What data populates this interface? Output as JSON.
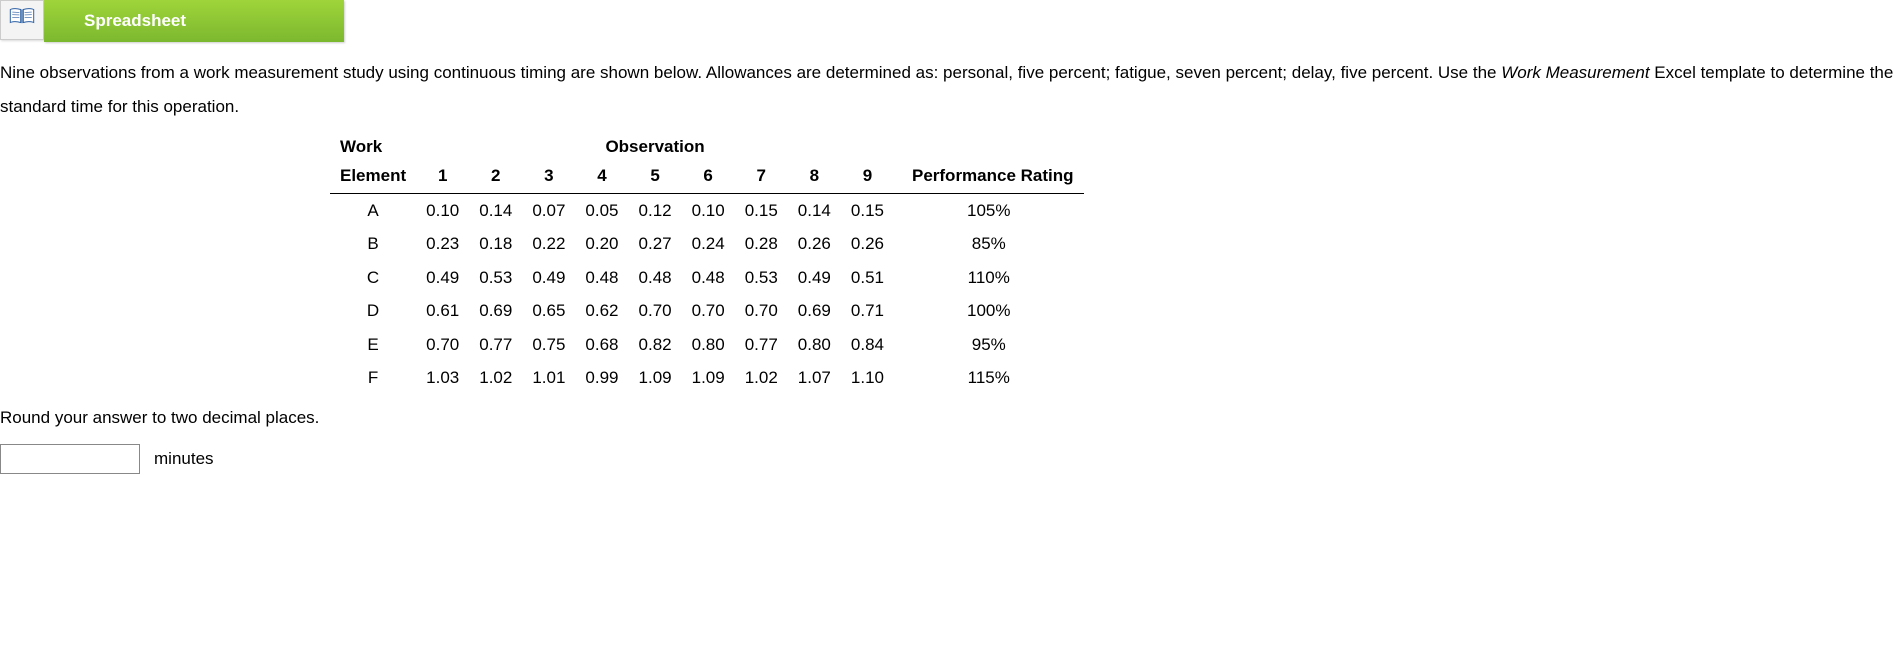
{
  "header": {
    "tab_label": "Spreadsheet"
  },
  "problem": {
    "text_part1": "Nine observations from a work measurement study using continuous timing are shown below. Allowances are determined as: personal, five percent; fatigue, seven percent; delay, five percent. Use the ",
    "text_emph": "Work Measurement",
    "text_part2": " Excel template to determine the standard time for this operation."
  },
  "table": {
    "header_group1": {
      "col1": "Work",
      "col_obs": "Observation"
    },
    "header_row": {
      "element": "Element",
      "obs": [
        "1",
        "2",
        "3",
        "4",
        "5",
        "6",
        "7",
        "8",
        "9"
      ],
      "perf": "Performance Rating"
    },
    "rows": [
      {
        "elem": "A",
        "v": [
          "0.10",
          "0.14",
          "0.07",
          "0.05",
          "0.12",
          "0.10",
          "0.15",
          "0.14",
          "0.15"
        ],
        "pr": "105%"
      },
      {
        "elem": "B",
        "v": [
          "0.23",
          "0.18",
          "0.22",
          "0.20",
          "0.27",
          "0.24",
          "0.28",
          "0.26",
          "0.26"
        ],
        "pr": "85%"
      },
      {
        "elem": "C",
        "v": [
          "0.49",
          "0.53",
          "0.49",
          "0.48",
          "0.48",
          "0.48",
          "0.53",
          "0.49",
          "0.51"
        ],
        "pr": "110%"
      },
      {
        "elem": "D",
        "v": [
          "0.61",
          "0.69",
          "0.65",
          "0.62",
          "0.70",
          "0.70",
          "0.70",
          "0.69",
          "0.71"
        ],
        "pr": "100%"
      },
      {
        "elem": "E",
        "v": [
          "0.70",
          "0.77",
          "0.75",
          "0.68",
          "0.82",
          "0.80",
          "0.77",
          "0.80",
          "0.84"
        ],
        "pr": "95%"
      },
      {
        "elem": "F",
        "v": [
          "1.03",
          "1.02",
          "1.01",
          "0.99",
          "1.09",
          "1.09",
          "1.02",
          "1.07",
          "1.10"
        ],
        "pr": "115%"
      }
    ]
  },
  "round_note": "Round your answer to two decimal places.",
  "answer": {
    "value": "",
    "unit": "minutes"
  }
}
